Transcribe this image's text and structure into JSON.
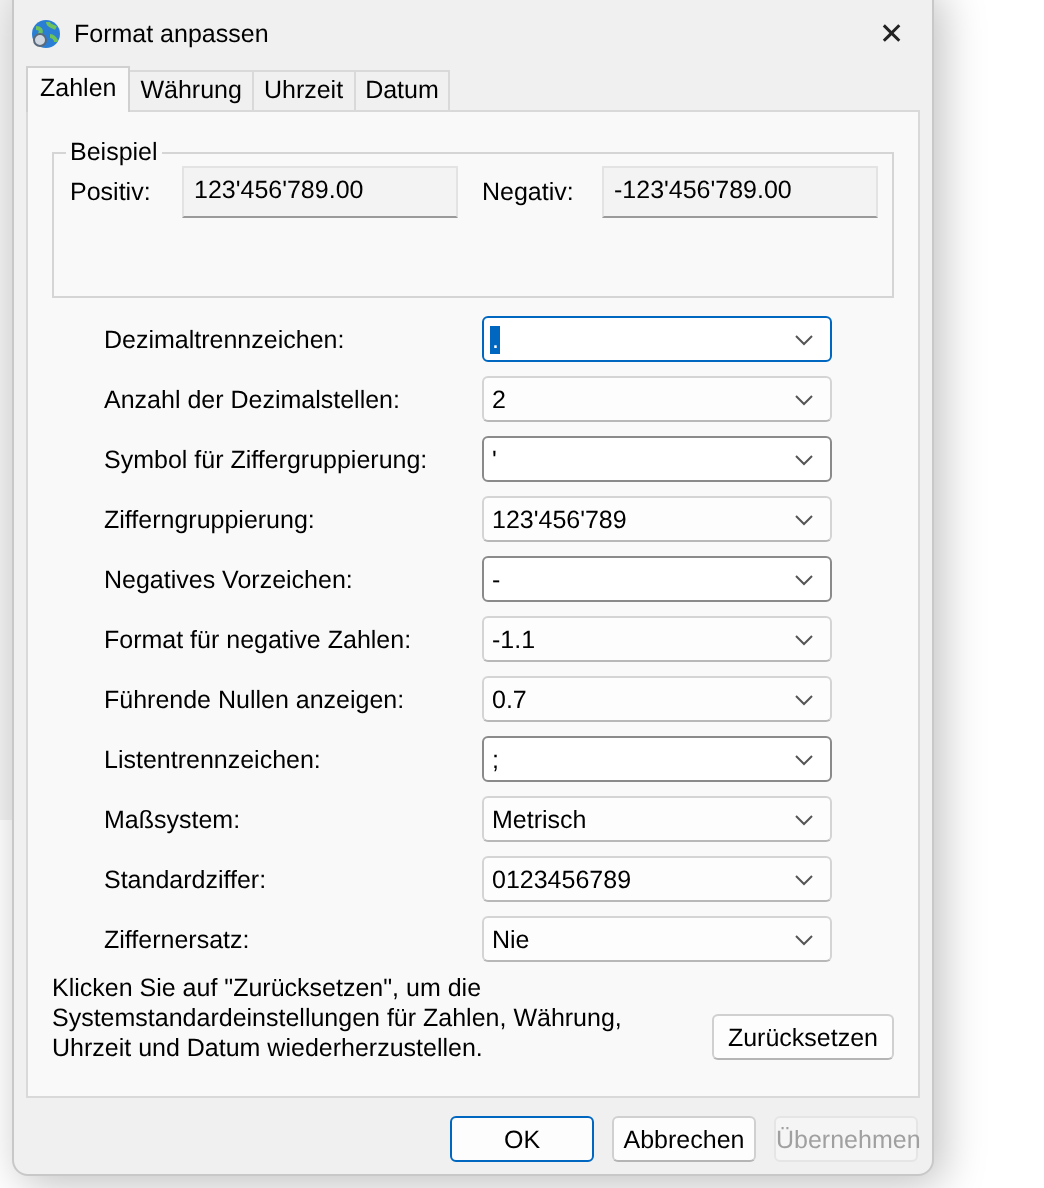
{
  "window": {
    "title": "Format anpassen",
    "close": "✕"
  },
  "tabs": [
    {
      "label": "Zahlen",
      "selected": true
    },
    {
      "label": "Währung",
      "selected": false
    },
    {
      "label": "Uhrzeit",
      "selected": false
    },
    {
      "label": "Datum",
      "selected": false
    }
  ],
  "example": {
    "title": "Beispiel",
    "positive_label": "Positiv:",
    "positive_value": "123'456'789.00",
    "negative_label": "Negativ:",
    "negative_value": "-123'456'789.00"
  },
  "settings": [
    {
      "label": "Dezimaltrennzeichen:",
      "value": ".",
      "kind": "editable",
      "focused": true
    },
    {
      "label": "Anzahl der Dezimalstellen:",
      "value": "2",
      "kind": "list",
      "focused": false
    },
    {
      "label": "Symbol für Ziffergruppierung:",
      "value": "'",
      "kind": "editable",
      "focused": false
    },
    {
      "label": "Zifferngruppierung:",
      "value": "123'456'789",
      "kind": "list",
      "focused": false
    },
    {
      "label": "Negatives Vorzeichen:",
      "value": "-",
      "kind": "editable",
      "focused": false
    },
    {
      "label": "Format für negative Zahlen:",
      "value": "-1.1",
      "kind": "list",
      "focused": false
    },
    {
      "label": "Führende Nullen anzeigen:",
      "value": "0.7",
      "kind": "list",
      "focused": false
    },
    {
      "label": "Listentrennzeichen:",
      "value": ";",
      "kind": "editable",
      "focused": false
    },
    {
      "label": "Maßsystem:",
      "value": "Metrisch",
      "kind": "list",
      "focused": false
    },
    {
      "label": "Standardziffer:",
      "value": "0123456789",
      "kind": "list",
      "focused": false
    },
    {
      "label": "Ziffernersatz:",
      "value": "Nie",
      "kind": "list",
      "focused": false
    }
  ],
  "reset": {
    "text": "Klicken Sie auf \"Zurücksetzen\", um die Systemstandardeinstellungen für Zahlen, Währung, Uhrzeit und Datum wiederherzustellen.",
    "button": "Zurücksetzen"
  },
  "buttons": [
    {
      "label": "OK",
      "kind": "default",
      "disabled": false
    },
    {
      "label": "Abbrechen",
      "kind": "normal",
      "disabled": false
    },
    {
      "label": "Übernehmen",
      "kind": "normal",
      "disabled": true
    }
  ]
}
